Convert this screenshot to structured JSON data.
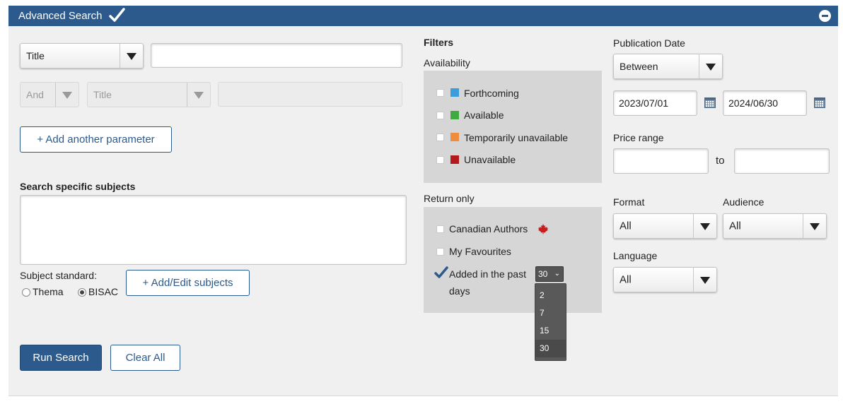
{
  "header": {
    "title": "Advanced Search"
  },
  "query": {
    "field_select": "Title",
    "field_value": "",
    "row2_operator": "And",
    "row2_field": "Title",
    "row2_value": "",
    "add_parameter_label": "+ Add another parameter"
  },
  "subjects": {
    "heading": "Search specific subjects",
    "value": "",
    "standard_label": "Subject standard:",
    "options": [
      "Thema",
      "BISAC"
    ],
    "selected": "BISAC",
    "add_edit_label": "+ Add/Edit subjects"
  },
  "actions": {
    "run_label": "Run Search",
    "clear_label": "Clear All"
  },
  "filters": {
    "heading": "Filters",
    "availability_label": "Availability",
    "availability": [
      {
        "label": "Forthcoming",
        "color": "#3b9ddb"
      },
      {
        "label": "Available",
        "color": "#3faa3f"
      },
      {
        "label": "Temporarily unavailable",
        "color": "#f08d3c"
      },
      {
        "label": "Unavailable",
        "color": "#b51a1a"
      }
    ],
    "return_only_label": "Return only",
    "return_only": {
      "canadian_authors": "Canadian Authors",
      "my_favourites": "My Favourites",
      "added_in_past_prefix": "Added in the past",
      "added_in_past_suffix": "days",
      "days_value": "30",
      "days_options": [
        "2",
        "7",
        "15",
        "30"
      ]
    }
  },
  "publication_date": {
    "label": "Publication Date",
    "mode": "Between",
    "from": "2023/07/01",
    "to": "2024/06/30"
  },
  "price_range": {
    "label": "Price range",
    "to_label": "to",
    "min": "",
    "max": ""
  },
  "format": {
    "label": "Format",
    "value": "All"
  },
  "audience": {
    "label": "Audience",
    "value": "All"
  },
  "language": {
    "label": "Language",
    "value": "All"
  },
  "colors": {
    "brand": "#2c5a8c",
    "panel": "#f0f0f0",
    "filter_box": "#d6d6d6",
    "maple_leaf": "#c41e1e"
  }
}
